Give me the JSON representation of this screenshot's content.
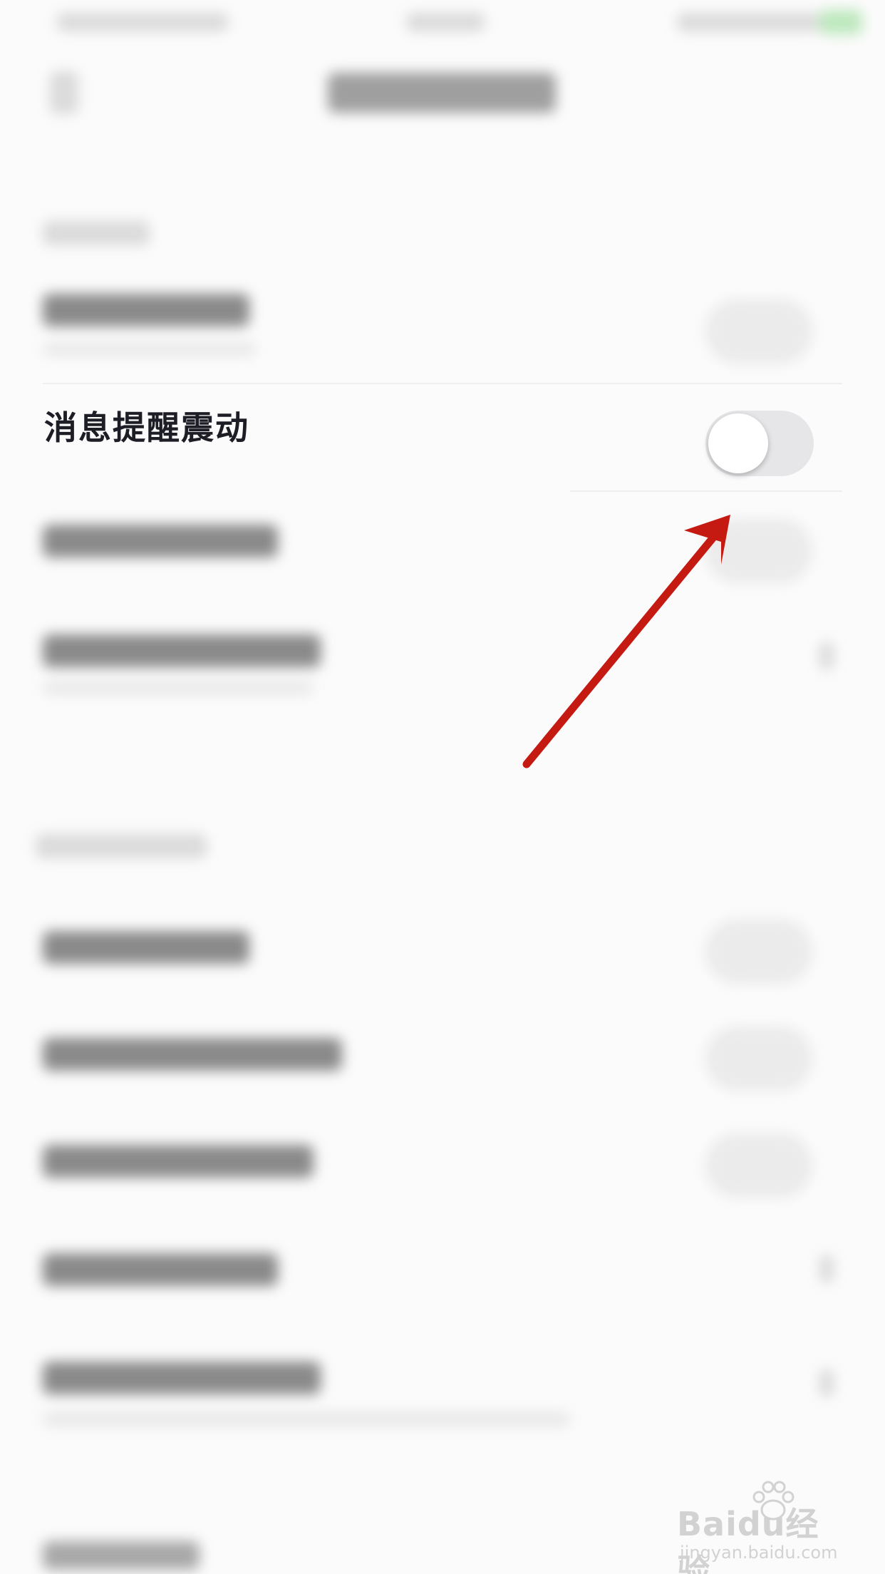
{
  "settings": {
    "vibration_row": {
      "label": "消息提醒震动",
      "toggle_on": false
    }
  },
  "colors": {
    "background": "#fbfbfb",
    "toggle_off": "#e6e6e9",
    "annotation_arrow": "#c41a12"
  },
  "watermark": {
    "brand": "Baidu经验",
    "url": "jingyan.baidu.com"
  }
}
